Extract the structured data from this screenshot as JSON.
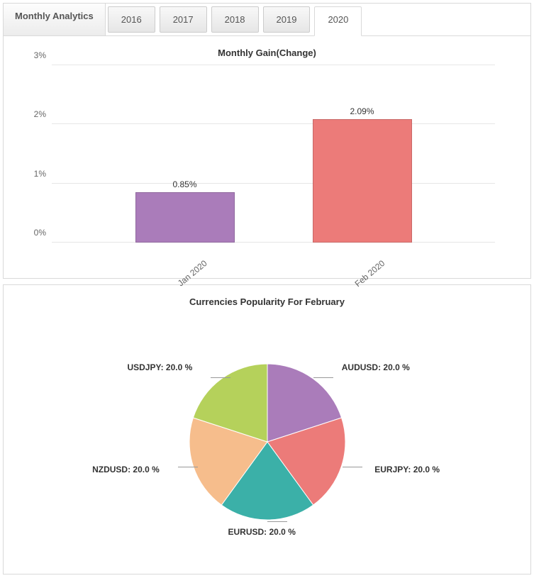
{
  "header": {
    "title": "Monthly Analytics",
    "tabs": [
      "2016",
      "2017",
      "2018",
      "2019",
      "2020"
    ],
    "active_tab": "2020"
  },
  "bar_chart": {
    "title": "Monthly Gain(Change)"
  },
  "pie_chart": {
    "title": "Currencies Popularity For February"
  },
  "chart_data": [
    {
      "type": "bar",
      "title": "Monthly Gain(Change)",
      "categories": [
        "Jan 2020",
        "Feb 2020"
      ],
      "values": [
        0.85,
        2.09
      ],
      "value_labels": [
        "0.85%",
        "2.09%"
      ],
      "colors": [
        "#aa7cba",
        "#ec7b79"
      ],
      "ylabel": "",
      "xlabel": "",
      "ylim": [
        0,
        3
      ],
      "yticks": [
        0,
        1,
        2,
        3
      ],
      "ytick_labels": [
        "0%",
        "1%",
        "2%",
        "3%"
      ]
    },
    {
      "type": "pie",
      "title": "Currencies Popularity For February",
      "series": [
        {
          "name": "AUDUSD",
          "value": 20.0,
          "label": "AUDUSD: 20.0 %",
          "color": "#aa7cba"
        },
        {
          "name": "EURJPY",
          "value": 20.0,
          "label": "EURJPY: 20.0 %",
          "color": "#ec7b79"
        },
        {
          "name": "EURUSD",
          "value": 20.0,
          "label": "EURUSD: 20.0 %",
          "color": "#3bb0a8"
        },
        {
          "name": "NZDUSD",
          "value": 20.0,
          "label": "NZDUSD: 20.0 %",
          "color": "#f6bd8c"
        },
        {
          "name": "USDJPY",
          "value": 20.0,
          "label": "USDJPY: 20.0 %",
          "color": "#b5d15b"
        }
      ]
    }
  ]
}
